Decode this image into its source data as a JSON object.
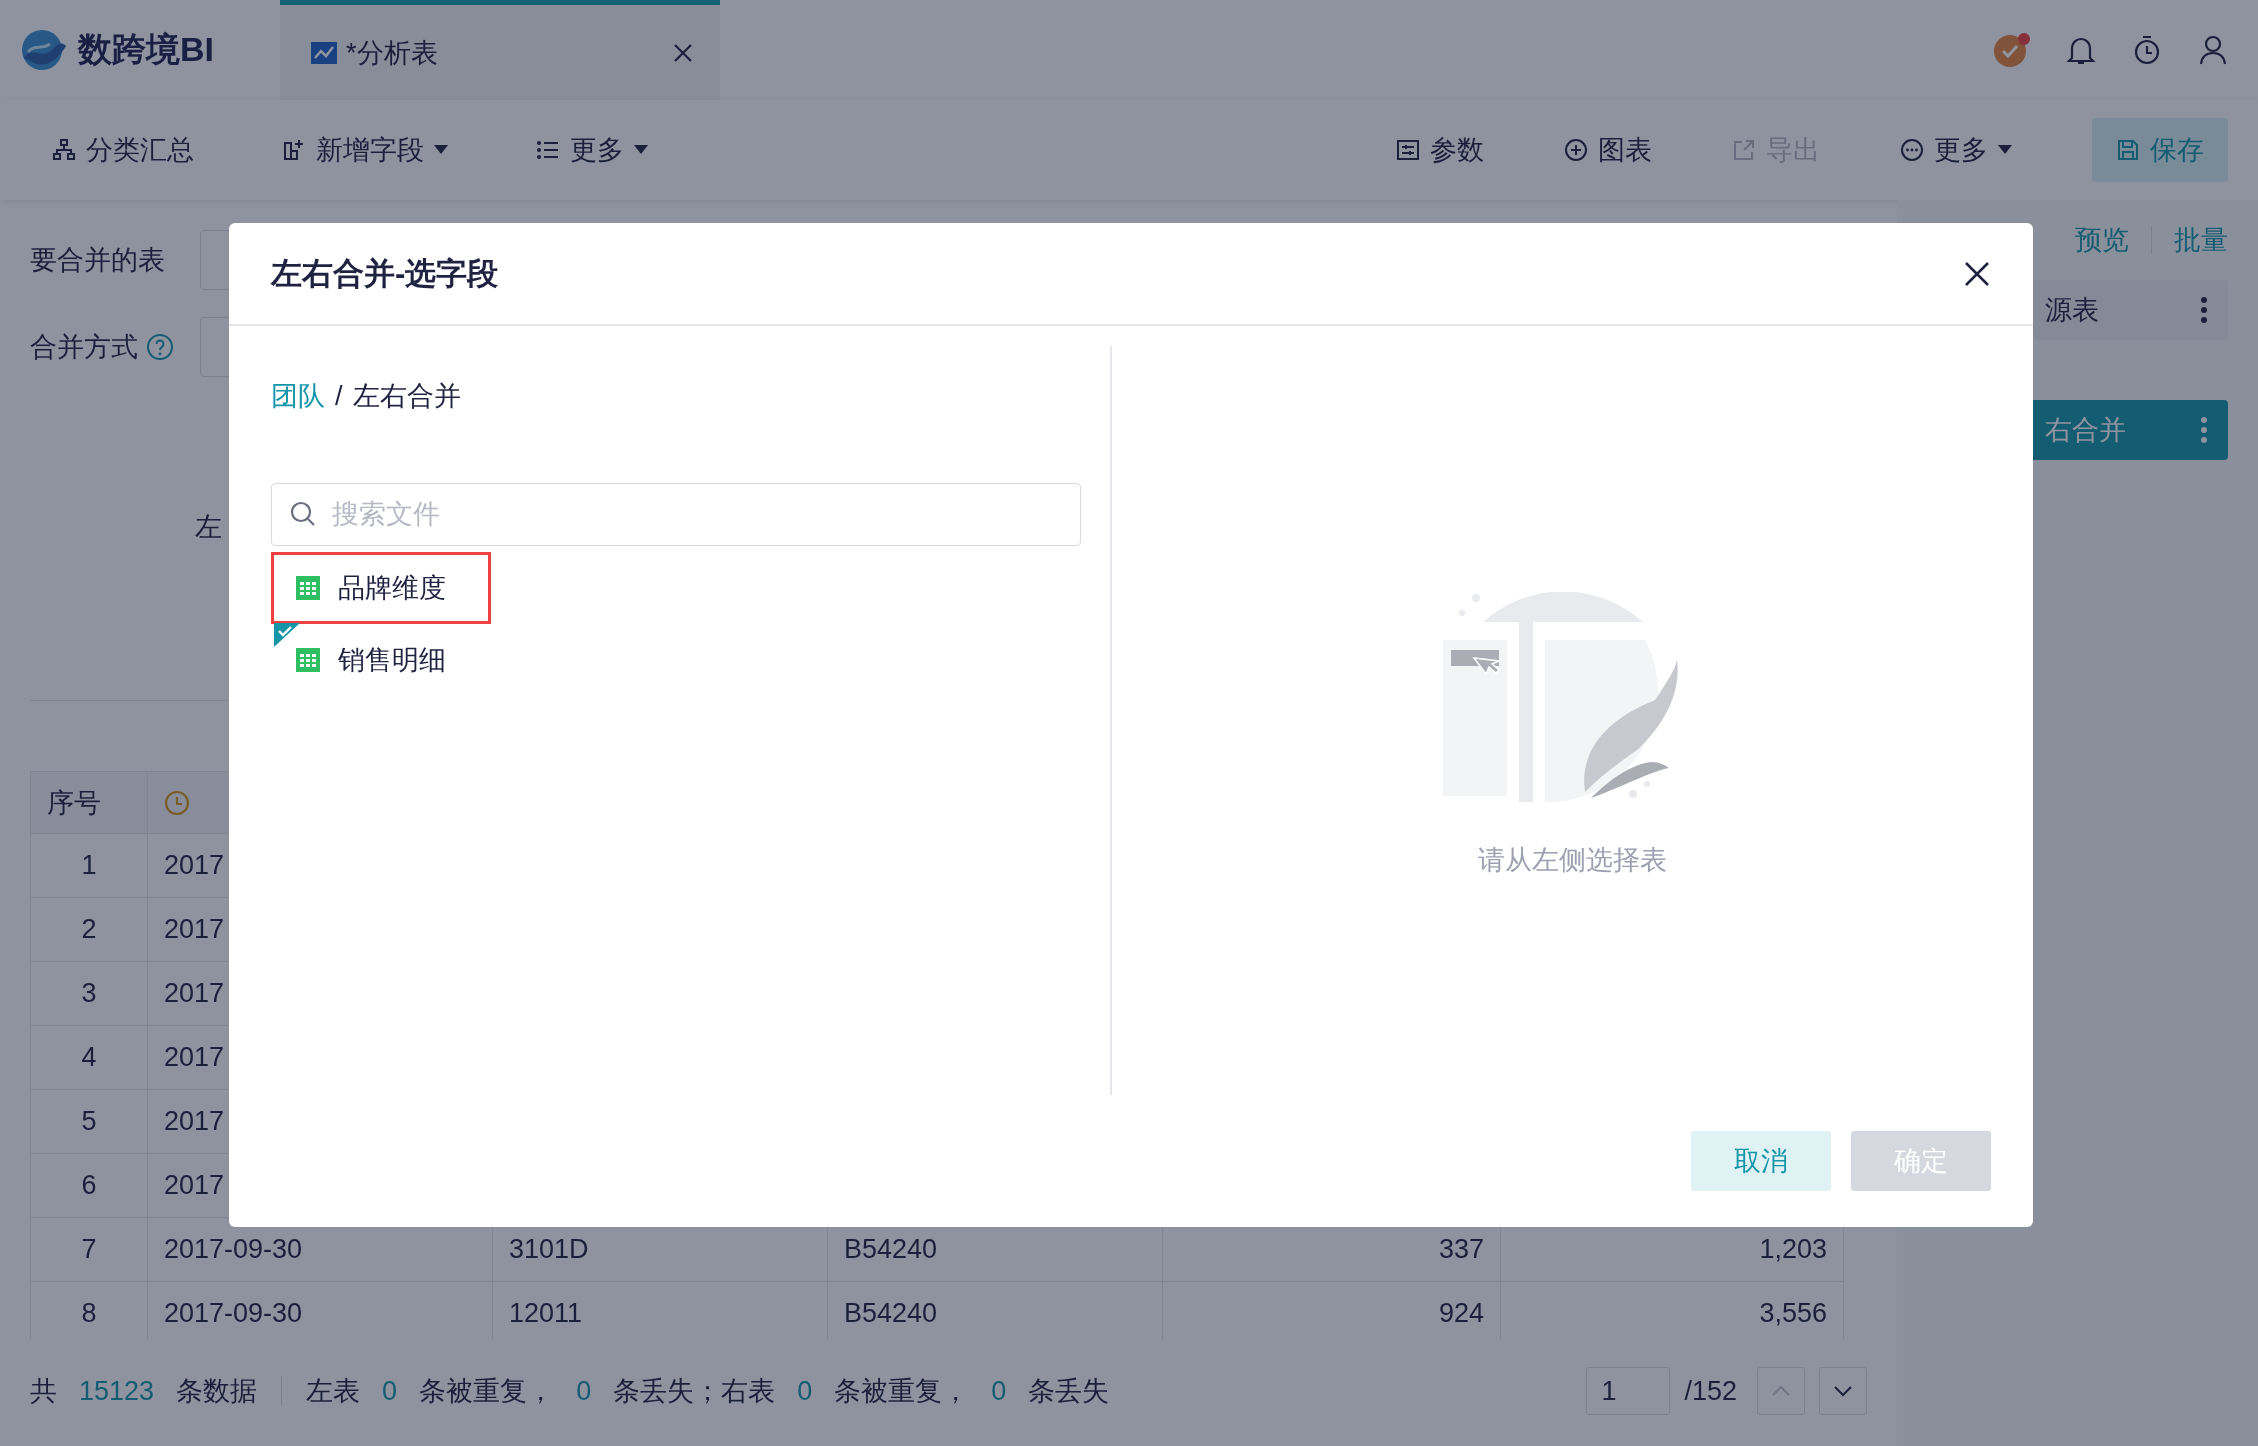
{
  "header": {
    "logo_text": "数跨境BI",
    "tabs": [
      {
        "label": "*分析表",
        "selected": true
      }
    ],
    "notification_dot": true
  },
  "toolbar": {
    "left": [
      {
        "label": "分类汇总",
        "kind": "button",
        "disabled": false
      },
      {
        "label": "新增字段",
        "kind": "dropdown",
        "disabled": false
      },
      {
        "label": "更多",
        "kind": "dropdown",
        "disabled": false
      }
    ],
    "right": [
      {
        "label": "参数",
        "kind": "button",
        "disabled": false
      },
      {
        "label": "图表",
        "kind": "button",
        "disabled": false
      },
      {
        "label": "导出",
        "kind": "button",
        "disabled": true
      },
      {
        "label": "更多",
        "kind": "dropdown",
        "disabled": false
      },
      {
        "label": "保存",
        "kind": "primary",
        "disabled": false
      }
    ]
  },
  "form": {
    "fields": [
      {
        "label": "要合并的表",
        "help": false
      },
      {
        "label": "合并方式",
        "help": true
      }
    ],
    "cut_label": "左"
  },
  "table": {
    "columns": [
      {
        "label": "序号",
        "kind": "text"
      },
      {
        "kind": "date"
      }
    ],
    "rows": [
      {
        "cells": [
          "1",
          "2017"
        ]
      },
      {
        "cells": [
          "2",
          "2017"
        ]
      },
      {
        "cells": [
          "3",
          "2017"
        ]
      },
      {
        "cells": [
          "4",
          "2017"
        ]
      },
      {
        "cells": [
          "5",
          "2017"
        ]
      },
      {
        "cells": [
          "6",
          "2017"
        ]
      },
      {
        "cells": [
          "7",
          "2017-09-30",
          "3101D",
          "B54240",
          "337",
          "1,203"
        ]
      },
      {
        "cells": [
          "8",
          "2017-09-30",
          "12011",
          "B54240",
          "924",
          "3,556"
        ]
      }
    ]
  },
  "status_bar": {
    "summary": [
      {
        "text": "共",
        "kind": "label"
      },
      {
        "text": "15123",
        "kind": "count"
      },
      {
        "text": "条数据",
        "kind": "label"
      }
    ],
    "details": [
      {
        "text": "左表",
        "kind": "label"
      },
      {
        "text": "0",
        "kind": "count"
      },
      {
        "text": "条被重复，",
        "kind": "label"
      },
      {
        "text": "0",
        "kind": "count"
      },
      {
        "text": "条丢失；右表",
        "kind": "label"
      },
      {
        "text": "0",
        "kind": "count"
      },
      {
        "text": "条被重复，",
        "kind": "label"
      },
      {
        "text": "0",
        "kind": "count"
      },
      {
        "text": "条丢失",
        "kind": "label"
      }
    ],
    "pagination": {
      "page": "1",
      "total": "/152"
    }
  },
  "right_panel": {
    "links": [
      "预览",
      "批量"
    ],
    "cards": [
      {
        "label": "源表",
        "selected": false
      },
      {
        "label": "右合并",
        "selected": true
      }
    ]
  },
  "dialog": {
    "title": "左右合并-选字段",
    "breadcrumb_separator": "/",
    "breadcrumb": [
      {
        "label": "团队",
        "link": true
      },
      {
        "label": "左右合并",
        "link": false
      }
    ],
    "search": {
      "placeholder": "搜索文件"
    },
    "files": [
      {
        "name": "品牌维度",
        "highlighted": true,
        "checked": false
      },
      {
        "name": "销售明细",
        "highlighted": false,
        "checked": true
      }
    ],
    "empty_text": "请从左侧选择表",
    "buttons": [
      {
        "label": "取消",
        "kind": "secondary",
        "disabled": false
      },
      {
        "label": "确定",
        "kind": "primary",
        "disabled": true
      }
    ]
  }
}
